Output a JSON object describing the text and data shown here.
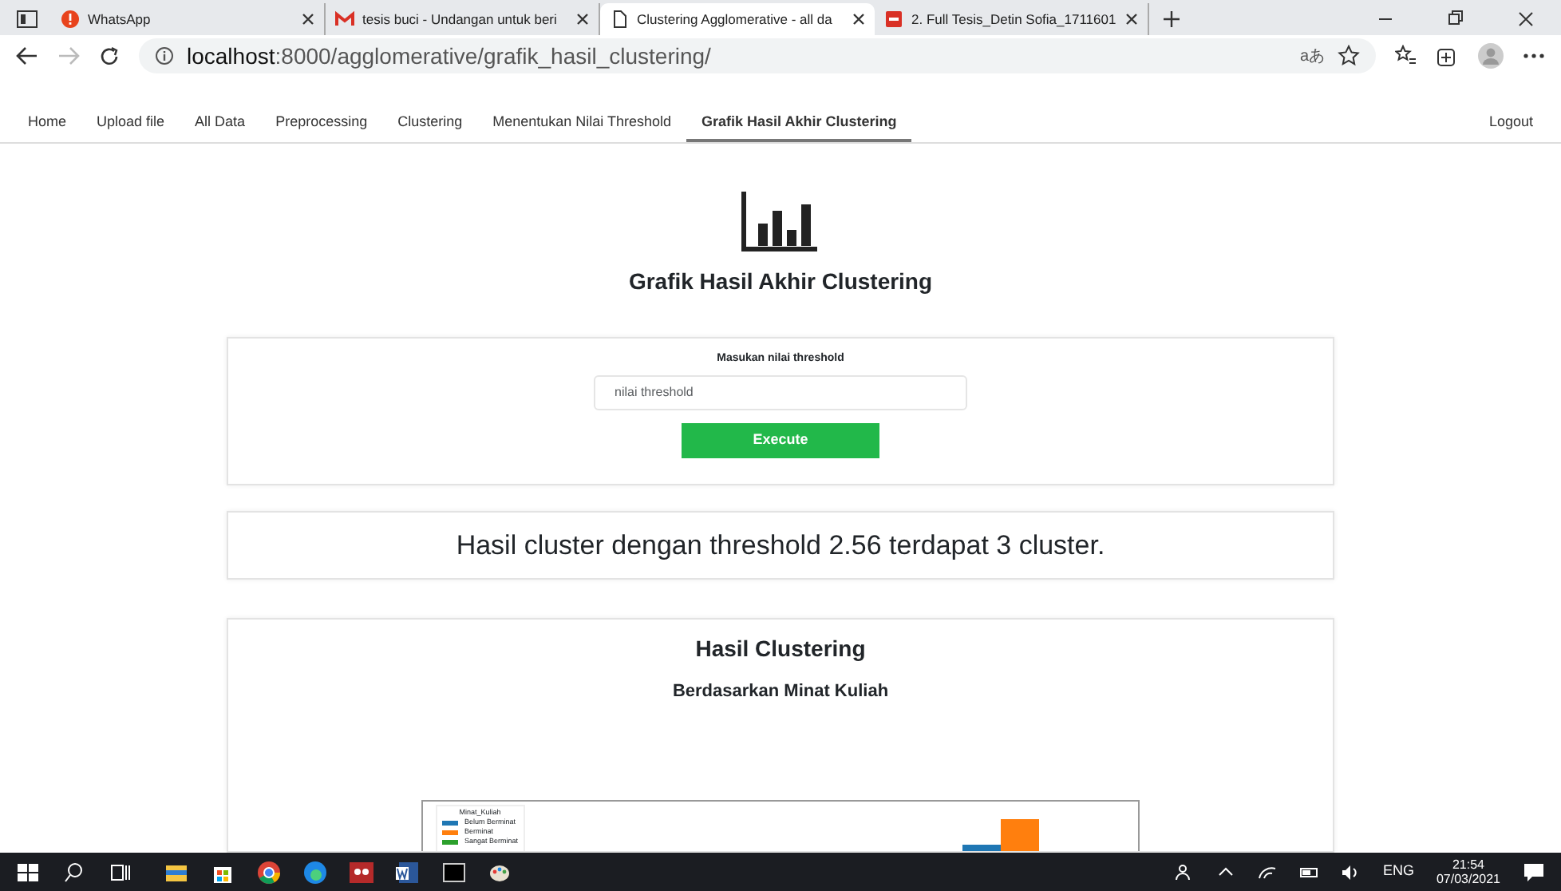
{
  "browser": {
    "tabs": [
      {
        "title": "WhatsApp",
        "selected": false
      },
      {
        "title": "tesis buci - Undangan untuk beri",
        "selected": false
      },
      {
        "title": "Clustering Agglomerative - all da",
        "selected": true
      },
      {
        "title": "2. Full Tesis_Detin Sofia_1711601",
        "selected": false
      }
    ],
    "address": {
      "host": "localhost",
      "path": ":8000/agglomerative/grafik_hasil_clustering/"
    },
    "reader_label": "aあ"
  },
  "nav": {
    "items": [
      {
        "label": "Home",
        "selected": false
      },
      {
        "label": "Upload file",
        "selected": false
      },
      {
        "label": "All Data",
        "selected": false
      },
      {
        "label": "Preprocessing",
        "selected": false
      },
      {
        "label": "Clustering",
        "selected": false
      },
      {
        "label": "Menentukan Nilai Threshold",
        "selected": false
      },
      {
        "label": "Grafik Hasil Akhir Clustering",
        "selected": true
      }
    ],
    "logout": "Logout"
  },
  "header": {
    "title": "Grafik Hasil Akhir Clustering"
  },
  "form": {
    "label": "Masukan nilai threshold",
    "placeholder": "nilai threshold",
    "button": "Execute"
  },
  "result": {
    "text": "Hasil cluster dengan threshold 2.56 terdapat 3 cluster."
  },
  "clustering": {
    "title": "Hasil Clustering",
    "subtitle": "Berdasarkan Minat Kuliah",
    "legend": {
      "title": "Minat_Kuliah",
      "items": [
        {
          "label": "Belum Berminat",
          "color": "#1f77b4"
        },
        {
          "label": "Berminat",
          "color": "#ff7f0e"
        },
        {
          "label": "Sangat Berminat",
          "color": "#2ca02c"
        }
      ]
    }
  },
  "taskbar": {
    "language": "ENG",
    "time": "21:54",
    "date": "07/03/2021"
  }
}
